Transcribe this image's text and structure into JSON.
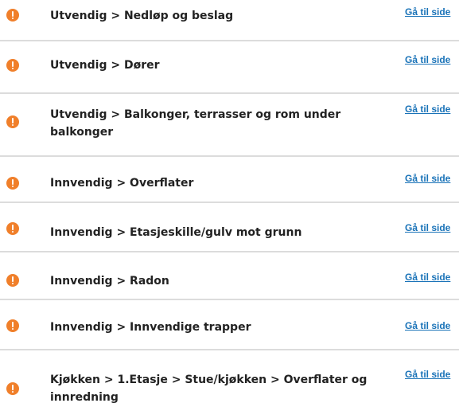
{
  "link_label": "Gå til side",
  "items": [
    {
      "title": "Utvendig > Nedløp og beslag"
    },
    {
      "title": "Utvendig > Dører"
    },
    {
      "title": "Utvendig > Balkonger, terrasser og rom under balkonger"
    },
    {
      "title": "Innvendig > Overflater"
    },
    {
      "title": "Innvendig > Etasjeskille/gulv mot grunn"
    },
    {
      "title": "Innvendig > Radon"
    },
    {
      "title": "Innvendig > Innvendige trapper"
    },
    {
      "title": "Kjøkken > 1.Etasje > Stue/kjøkken  > Overflater og innredning"
    }
  ],
  "colors": {
    "alert_icon": "#f07f2a",
    "link": "#1a73b8",
    "divider": "#dcdcdc"
  },
  "icon": "exclamation-circle-icon"
}
